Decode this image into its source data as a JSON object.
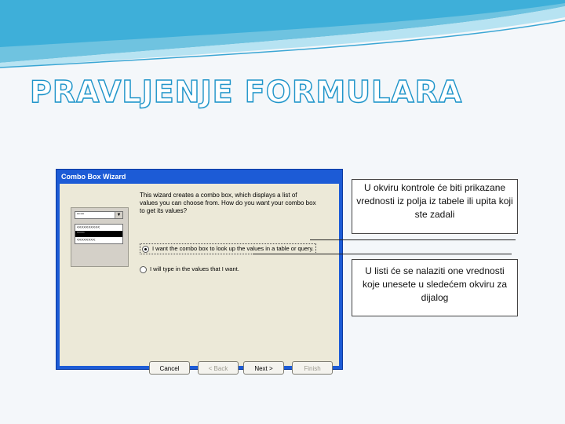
{
  "slide": {
    "title": "PRAVLJENJE FORMULARA"
  },
  "wizard": {
    "window_title": "Combo Box Wizard",
    "intro": "This wizard creates a combo box, which displays a list of values you can choose from. How do you want your combo box to get its values?",
    "option1": "I want the combo box to look up the values in a table or query.",
    "option2": "I will type in the values that I want.",
    "option1_selected": true,
    "preview": {
      "combo_text": "''''''''",
      "rows": [
        "<<<<<<<<<<",
        "''''''''''",
        "<<<<<<<<"
      ]
    },
    "buttons": {
      "cancel": "Cancel",
      "back": "< Back",
      "next": "Next >",
      "finish": "Finish"
    }
  },
  "callouts": {
    "first": "U okviru kontrole će biti prikazane vrednosti iz polja iz tabele ili upita koji ste zadali",
    "second": "U listi će se nalaziti one vrednosti koje unesete u sledećem okviru za dijalog"
  },
  "colors": {
    "title_outline": "#1f94c9",
    "window_frame": "#1c5bd6",
    "dialog_bg": "#ece9d8"
  }
}
